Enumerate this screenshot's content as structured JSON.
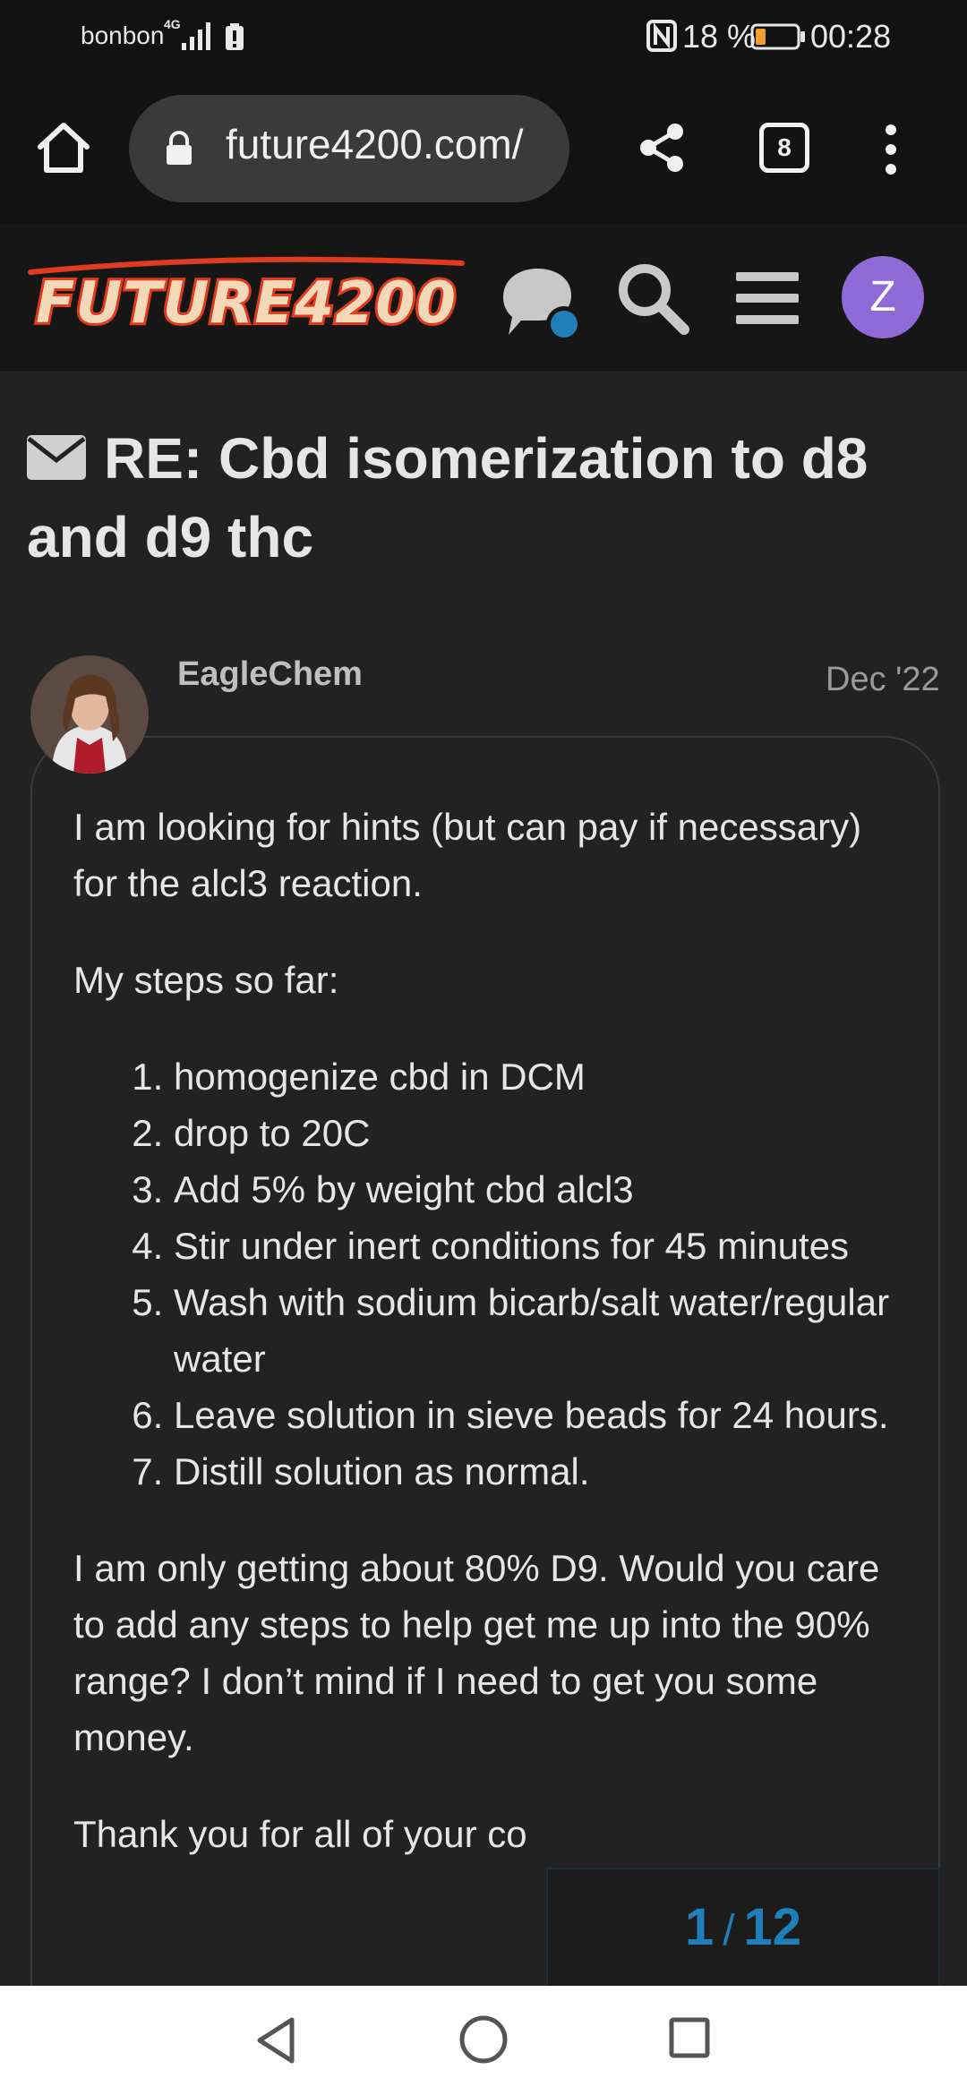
{
  "status_bar": {
    "carrier": "bonbon",
    "network": "4G",
    "battery": "18 %",
    "time": "00:28"
  },
  "browser": {
    "url": "future4200.com/",
    "tab_count": "8"
  },
  "site": {
    "logo": "FUTURE4200",
    "user_initial": "Z",
    "colors": {
      "accent": "#1f7fb8",
      "avatar_bg": "#8f6ad6",
      "logo_red": "#e23a1e"
    }
  },
  "topic": {
    "title": "RE: Cbd isomerization to d8 and d9 thc"
  },
  "post": {
    "username": "EagleChem",
    "date": "Dec '22",
    "intro": "I am looking for hints (but can pay if necessary) for the alcl3 reaction.",
    "steps_heading": "My steps so far:",
    "steps": [
      "homogenize cbd in DCM",
      "drop to 20C",
      "Add 5% by weight cbd alcl3",
      "Stir under inert conditions for 45 minutes",
      "Wash with sodium bicarb/salt water/regular water",
      "Leave solution in sieve beads for 24 hours.",
      "Distill solution as normal."
    ],
    "followup": "I am only getting about 80% D9. Would you care to add any steps to help get me up into the 90% range? I don’t mind if I need to get you some money.",
    "closing": "Thank you for all of your co"
  },
  "pagination": {
    "current": "1",
    "separator": "/",
    "total": "12"
  }
}
